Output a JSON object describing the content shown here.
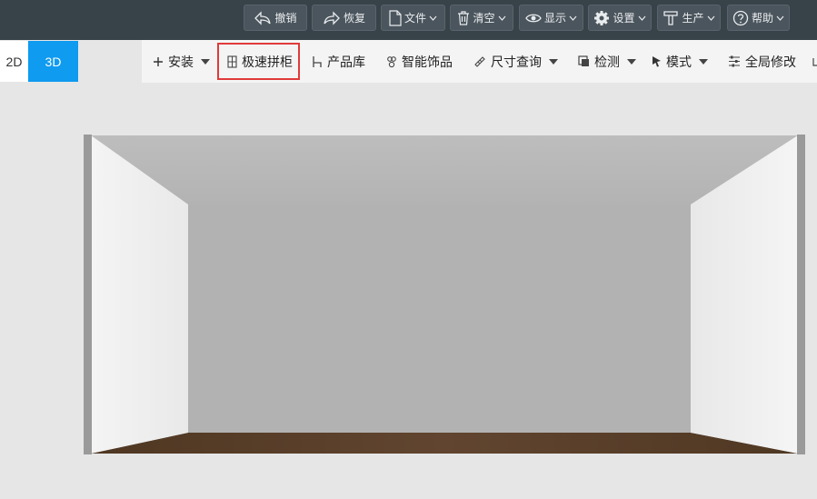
{
  "topbar": {
    "buttons": [
      {
        "label": "撤销",
        "icon": "undo-icon"
      },
      {
        "label": "恢复",
        "icon": "redo-icon"
      },
      {
        "label": "文件",
        "icon": "file-icon"
      },
      {
        "label": "清空",
        "icon": "trash-icon"
      },
      {
        "label": "显示",
        "icon": "eye-icon"
      },
      {
        "label": "设置",
        "icon": "gear-icon"
      },
      {
        "label": "生产",
        "icon": "hammer-icon"
      },
      {
        "label": "帮助",
        "icon": "help-icon"
      }
    ]
  },
  "mode": {
    "d2": "2D",
    "d3": "3D",
    "active": "3D"
  },
  "toolbar": {
    "items": [
      {
        "label": "安装",
        "icon": "plus-icon"
      },
      {
        "label": "极速拼柜",
        "icon": "cabinet-icon"
      },
      {
        "label": "产品库",
        "icon": "chair-icon"
      },
      {
        "label": "智能饰品",
        "icon": "ornament-icon"
      },
      {
        "label": "尺寸查询",
        "icon": "ruler-icon"
      },
      {
        "label": "检测",
        "icon": "inspect-icon"
      },
      {
        "label": "模式",
        "icon": "cursor-icon"
      },
      {
        "label": "全局修改",
        "icon": "sliders-icon"
      }
    ]
  },
  "colors": {
    "topbar_bg": "#384249",
    "accent_blue": "#0f9bf0",
    "highlight_red": "#e03a3a",
    "floor_wood": "#5a4029"
  }
}
